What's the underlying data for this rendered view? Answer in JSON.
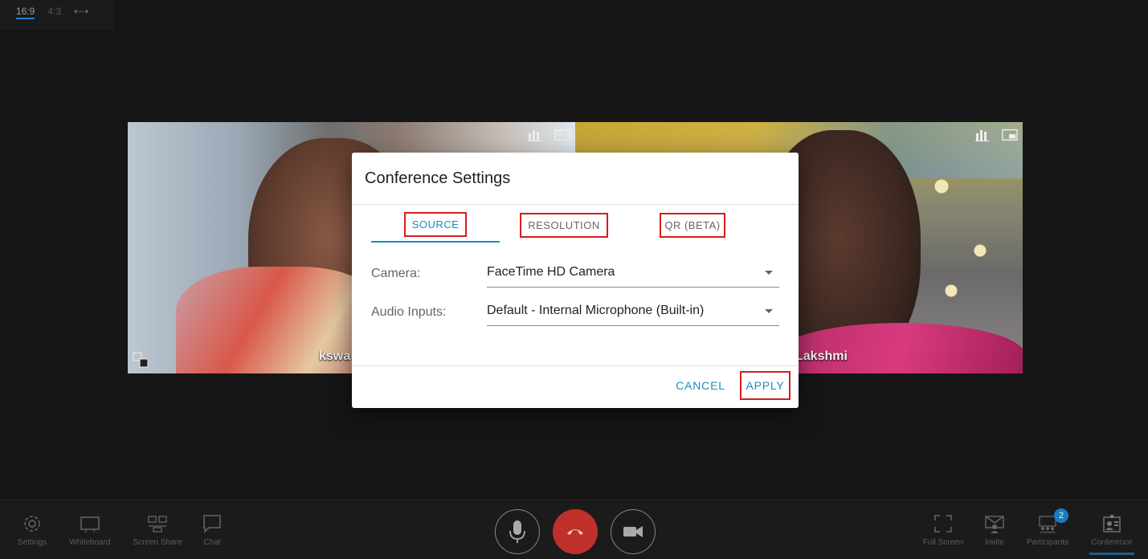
{
  "aspect": {
    "options": [
      "16:9",
      "4:3"
    ],
    "active": "16:9",
    "swap_icon": "swap-arrows-icon"
  },
  "participants": [
    {
      "name": "kswa",
      "icons": [
        "bar-chart-icon",
        "screen-icon"
      ]
    },
    {
      "name": "Lakshmi",
      "icons": [
        "bar-chart-icon",
        "pip-icon"
      ]
    }
  ],
  "dialog": {
    "title": "Conference Settings",
    "tabs": [
      {
        "label": "SOURCE",
        "active": true
      },
      {
        "label": "RESOLUTION",
        "active": false
      },
      {
        "label": "QR (BETA)",
        "active": false
      }
    ],
    "fields": [
      {
        "label": "Camera:",
        "value": "FaceTime HD Camera"
      },
      {
        "label": "Audio Inputs:",
        "value": "Default - Internal Microphone (Built-in)"
      }
    ],
    "cancel": "CANCEL",
    "apply": "APPLY",
    "accent": "#1c8bc0",
    "highlight": "#d91c1c"
  },
  "toolbar": {
    "left": [
      {
        "label": "Settings",
        "icon": "gear-icon"
      },
      {
        "label": "Whiteboard",
        "icon": "whiteboard-icon"
      },
      {
        "label": "Screen Share",
        "icon": "screen-share-icon"
      },
      {
        "label": "Chat",
        "icon": "chat-icon"
      }
    ],
    "center": [
      {
        "icon": "microphone-icon"
      },
      {
        "icon": "hang-up-icon"
      },
      {
        "icon": "video-camera-icon"
      }
    ],
    "right": [
      {
        "label": "Full Screen",
        "icon": "fullscreen-icon"
      },
      {
        "label": "Invite",
        "icon": "invite-icon"
      },
      {
        "label": "Participants",
        "icon": "participants-icon",
        "badge": "2"
      },
      {
        "label": "Conference",
        "icon": "conference-icon"
      }
    ],
    "hangup_color": "#c0302a"
  }
}
